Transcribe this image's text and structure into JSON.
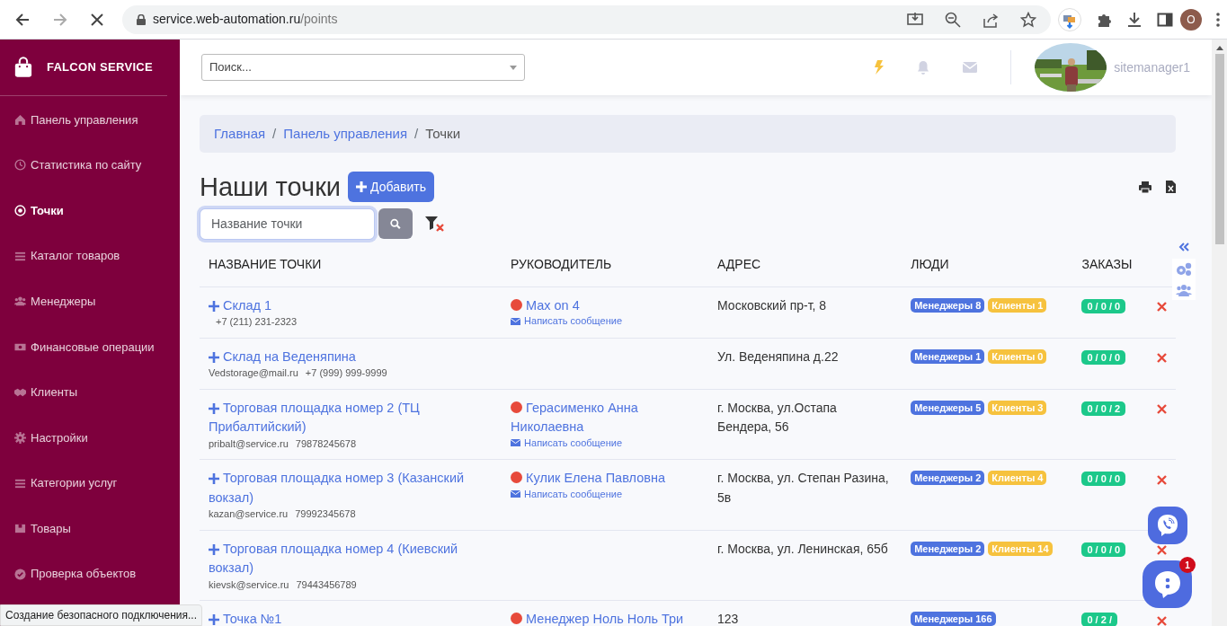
{
  "browser": {
    "url_host": "service.web-automation.ru",
    "url_path": "/points",
    "profile_initial": "O",
    "status": "Создание безопасного подключения..."
  },
  "sidebar": {
    "brand": "FALCON SERVICE",
    "items": [
      {
        "label": "Панель управления",
        "selected": false
      },
      {
        "label": "Статистика по сайту",
        "selected": false
      },
      {
        "label": "Точки",
        "selected": true
      },
      {
        "label": "Каталог товаров",
        "selected": false
      },
      {
        "label": "Менеджеры",
        "selected": false
      },
      {
        "label": "Финансовые операции",
        "selected": false
      },
      {
        "label": "Клиенты",
        "selected": false
      },
      {
        "label": "Настройки",
        "selected": false
      },
      {
        "label": "Категории услуг",
        "selected": false
      },
      {
        "label": "Товары",
        "selected": false
      },
      {
        "label": "Проверка объектов",
        "selected": false
      }
    ]
  },
  "header": {
    "search_placeholder": "Поиск...",
    "username": "sitemanager1"
  },
  "breadcrumb": [
    {
      "label": "Главная",
      "kind": "link"
    },
    {
      "label": "/",
      "kind": "separator"
    },
    {
      "label": "Панель управления",
      "kind": "link"
    },
    {
      "label": "/",
      "kind": "separator"
    },
    {
      "label": "Точки",
      "kind": "current"
    }
  ],
  "title": "Наши точки",
  "add_button": "Добавить",
  "filter": {
    "placeholder": "Название точки"
  },
  "table": {
    "columns": [
      "НАЗВАНИЕ ТОЧКИ",
      "РУКОВОДИТЕЛЬ",
      "АДРЕС",
      "ЛЮДИ",
      "ЗАКАЗЫ"
    ],
    "rows": [
      {
        "name": "Склад 1",
        "contacts": [
          "+7 (211) 231-2323"
        ],
        "manager": "Max on 4",
        "message": "Написать сообщение",
        "address": "Московский пр-т, 8",
        "managers_badge": "Менеджеры 8",
        "clients_badge": "Клиенты 1",
        "orders": "0 / 0 / 0"
      },
      {
        "name": "Склад на Веденяпина",
        "contacts": [
          "Vedstorage@mail.ru",
          "+7 (999) 999-9999"
        ],
        "address": "Ул. Веденяпина д.22",
        "managers_badge": "Менеджеры 1",
        "clients_badge": "Клиенты 0",
        "orders": "0 / 0 / 0"
      },
      {
        "name": "Торговая площадка номер 2 (ТЦ Прибалтийский)",
        "contacts": [
          "pribalt@service.ru",
          "79878245678"
        ],
        "manager": "Герасименко Анна Николаевна",
        "message": "Написать сообщение",
        "address": "г. Москва, ул.Остапа Бендера, 56",
        "managers_badge": "Менеджеры 5",
        "clients_badge": "Клиенты 3",
        "orders": "0 / 0 / 2"
      },
      {
        "name": "Торговая площадка номер 3 (Казанский вокзал)",
        "contacts": [
          "kazan@service.ru",
          "79992345678"
        ],
        "manager": "Кулик Елена Павловна",
        "message": "Написать сообщение",
        "address": "г. Москва, ул. Степан Разина, 5в",
        "managers_badge": "Менеджеры 2",
        "clients_badge": "Клиенты 4",
        "orders": "0 / 0 / 0"
      },
      {
        "name": "Торговая площадка номер 4 (Киевский вокзал)",
        "contacts": [
          "kievsk@service.ru",
          "79443456789"
        ],
        "address": "г. Москва, ул. Ленинская, 65б",
        "managers_badge": "Менеджеры 2",
        "clients_badge": "Клиенты 14",
        "orders": "0 / 0 / 0"
      },
      {
        "name": "Точка №1",
        "contacts": [],
        "manager": "Менеджер Ноль Ноль Три",
        "address": "123",
        "managers_badge": "Менеджеры 166",
        "orders": "0 / 2 /"
      }
    ]
  },
  "chat": {
    "badge": "1"
  }
}
